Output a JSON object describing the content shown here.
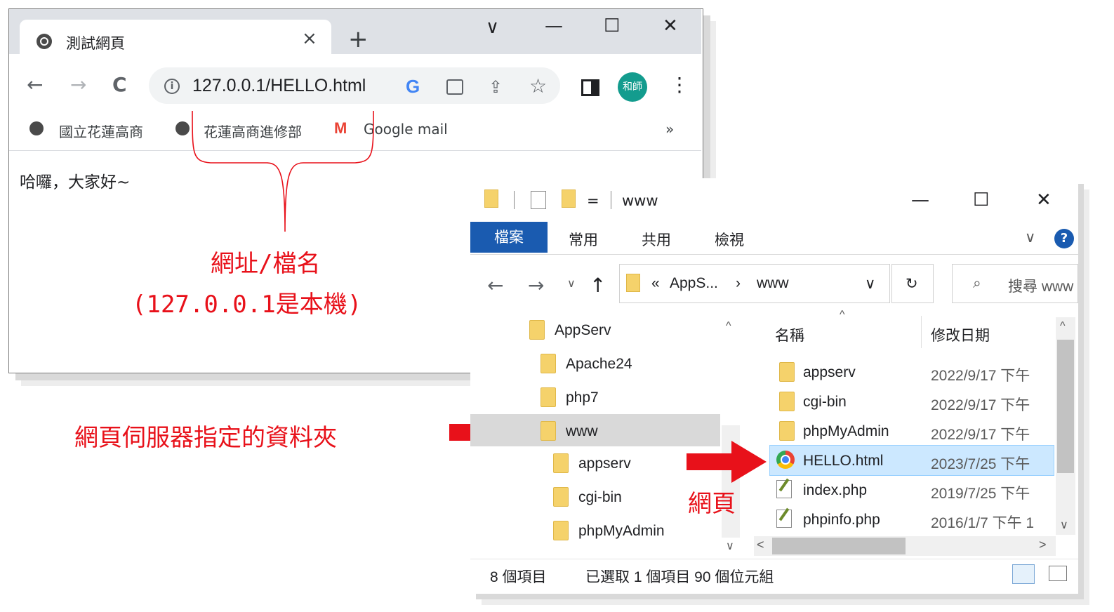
{
  "browser": {
    "tab_title": "測試網頁",
    "tab_close": "×",
    "new_tab": "+",
    "window_controls": {
      "dropdown": "∨",
      "minimize": "—",
      "maximize": "☐",
      "close": "✕"
    },
    "nav": {
      "back": "←",
      "forward": "→",
      "reload": "C"
    },
    "url": "127.0.0.1/HELLO.html",
    "url_info": "i",
    "profile": "和師",
    "menu": "⋮",
    "bookmarks": [
      "國立花蓮高商",
      "花蓮高商進修部",
      "Google mail"
    ],
    "gmail_icon": "M",
    "bookmarks_more": "»",
    "page_text": "哈囉，大家好~"
  },
  "annotations": {
    "url_note_line1": "網址/檔名",
    "url_note_line2": "(127.0.0.1是本機)",
    "folder_note": "網頁伺服器指定的資料夾",
    "file_note": "網頁"
  },
  "explorer": {
    "title": "www",
    "qat_dropdown": "=",
    "window_controls": {
      "minimize": "—",
      "maximize": "☐",
      "close": "✕"
    },
    "ribbon_tabs": [
      "檔案",
      "常用",
      "共用",
      "檢視"
    ],
    "ribbon_expand": "∨",
    "help": "?",
    "nav": {
      "back": "←",
      "forward": "→",
      "recent": "∨",
      "up": "↑"
    },
    "address": {
      "prefix": "«",
      "crumbs": [
        "AppS...",
        "www"
      ],
      "sep": "›",
      "dropdown": "∨"
    },
    "refresh": "↻",
    "search_placeholder": "搜尋 www",
    "tree": [
      "AppServ",
      "Apache24",
      "php7",
      "www",
      "appserv",
      "cgi-bin",
      "phpMyAdmin"
    ],
    "tree_selected": "www",
    "columns": {
      "name": "名稱",
      "modified": "修改日期",
      "sort_arrow": "^"
    },
    "files": [
      {
        "name": "appserv",
        "date": "2022/9/17 下午",
        "type": "folder"
      },
      {
        "name": "cgi-bin",
        "date": "2022/9/17 下午",
        "type": "folder"
      },
      {
        "name": "phpMyAdmin",
        "date": "2022/9/17 下午",
        "type": "folder"
      },
      {
        "name": "HELLO.html",
        "date": "2023/7/25 下午",
        "type": "chrome"
      },
      {
        "name": "index.php",
        "date": "2019/7/25 下午",
        "type": "php"
      },
      {
        "name": "phpinfo.php",
        "date": "2016/1/7 下午 1",
        "type": "php"
      }
    ],
    "selected_file": "HELLO.html",
    "status": {
      "count": "8 個項目",
      "selection": "已選取 1 個項目  90 個位元組"
    },
    "scroll": {
      "up": "^",
      "down": "∨",
      "left": "<",
      "right": ">"
    }
  },
  "colors": {
    "annotation_red": "#e8111a",
    "ribbon_blue": "#1a5bb0",
    "selection_blue": "#cce8ff",
    "avatar_teal": "#139c8e"
  }
}
